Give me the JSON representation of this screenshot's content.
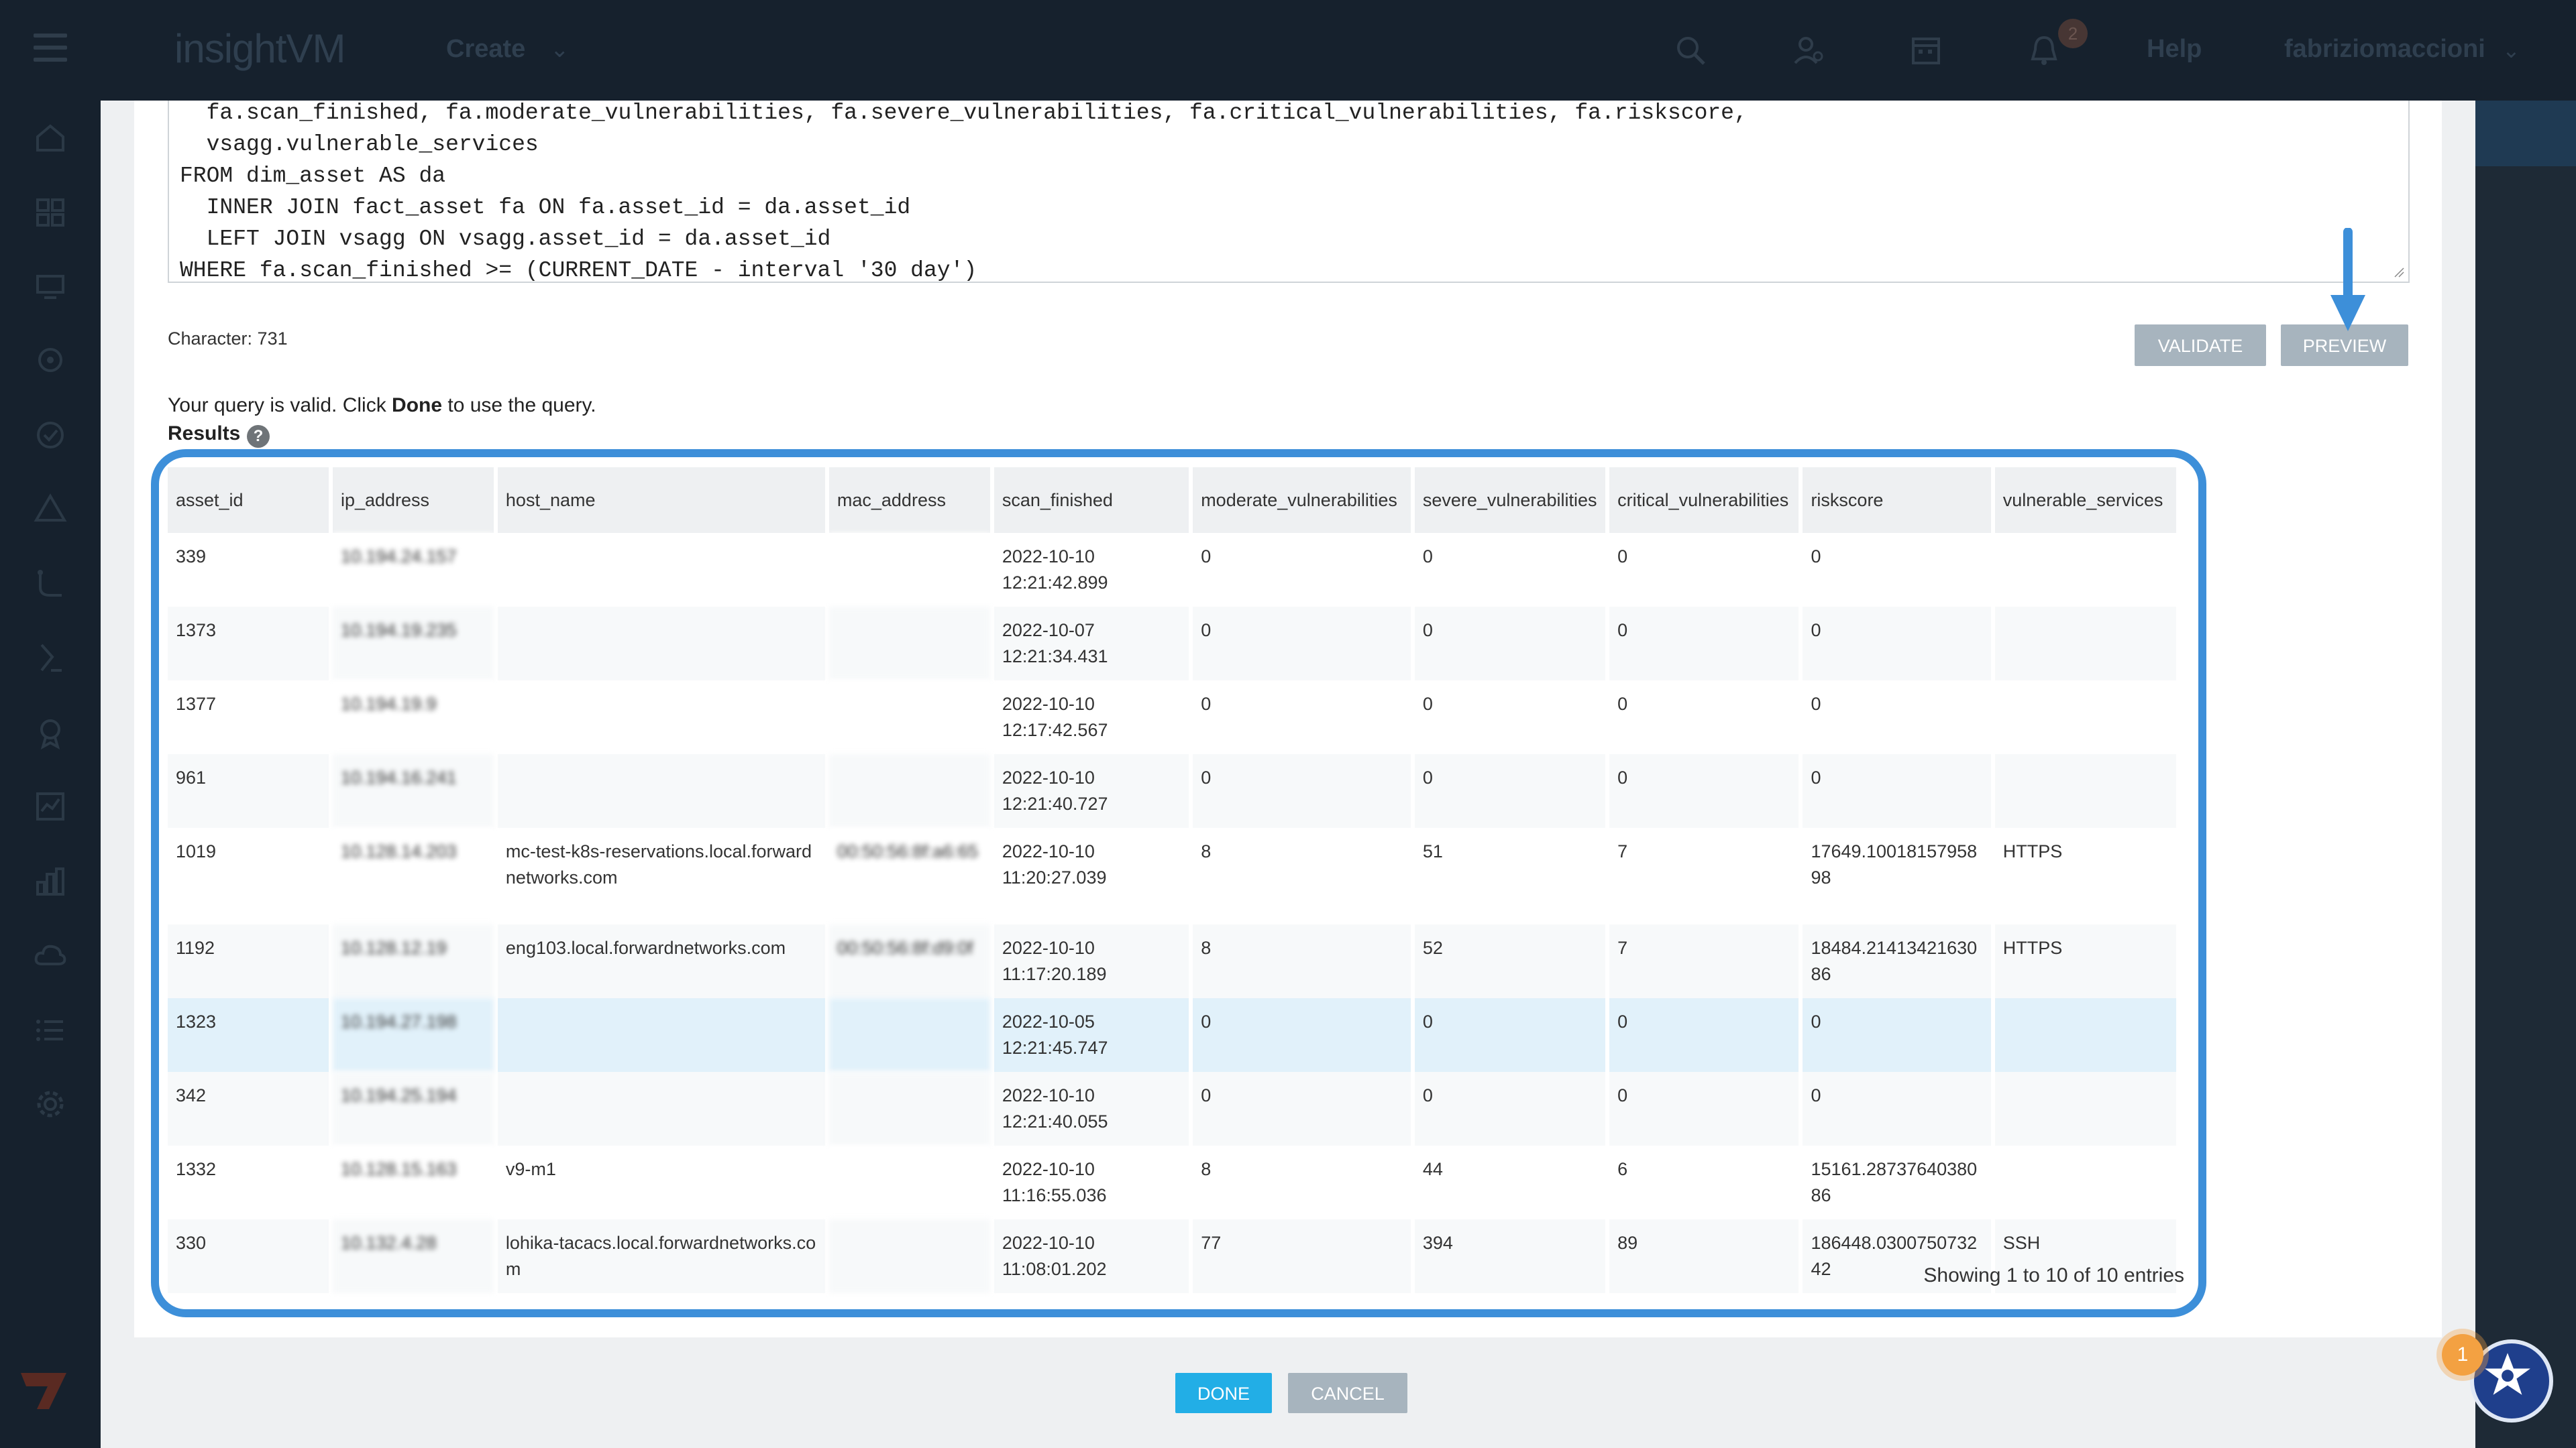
{
  "nav": {
    "logo": "insightVM",
    "create": "Create",
    "help": "Help",
    "user": "fabriziomaccioni",
    "notification_count": "2"
  },
  "sql": {
    "lines": [
      "  fa.scan_finished, fa.moderate_vulnerabilities, fa.severe_vulnerabilities, fa.critical_vulnerabilities, fa.riskscore,",
      "  vsagg.vulnerable_services",
      "FROM dim_asset AS da",
      "  INNER JOIN fact_asset fa ON fa.asset_id = da.asset_id",
      "  LEFT JOIN vsagg ON vsagg.asset_id = da.asset_id",
      "WHERE fa.scan_finished >= (CURRENT_DATE - interval '30 day')"
    ]
  },
  "editor": {
    "character_count": "Character: 731",
    "validate_label": "VALIDATE",
    "preview_label": "PREVIEW",
    "valid_msg_pre": "Your query is valid. Click ",
    "valid_msg_bold": "Done",
    "valid_msg_post": " to use the query.",
    "results_label": "Results",
    "help_glyph": "?"
  },
  "table": {
    "columns": [
      "asset_id",
      "ip_address",
      "host_name",
      "mac_address",
      "scan_finished",
      "moderate_vulnerabilities",
      "severe_vulnerabilities",
      "critical_vulnerabilities",
      "riskscore",
      "vulnerable_services"
    ],
    "rows": [
      {
        "asset_id": "339",
        "ip": "10.194.24.157",
        "host": "",
        "mac": "",
        "scan_date": "2022-10-10",
        "scan_time": "12:21:42.899",
        "moderate": "0",
        "severe": "0",
        "critical": "0",
        "risk_a": "0",
        "risk_b": "",
        "services": ""
      },
      {
        "asset_id": "1373",
        "ip": "10.194.19.235",
        "host": "",
        "mac": "",
        "scan_date": "2022-10-07",
        "scan_time": "12:21:34.431",
        "moderate": "0",
        "severe": "0",
        "critical": "0",
        "risk_a": "0",
        "risk_b": "",
        "services": ""
      },
      {
        "asset_id": "1377",
        "ip": "10.194.19.9",
        "host": "",
        "mac": "",
        "scan_date": "2022-10-10",
        "scan_time": "12:17:42.567",
        "moderate": "0",
        "severe": "0",
        "critical": "0",
        "risk_a": "0",
        "risk_b": "",
        "services": ""
      },
      {
        "asset_id": "961",
        "ip": "10.194.16.241",
        "host": "",
        "mac": "",
        "scan_date": "2022-10-10",
        "scan_time": "12:21:40.727",
        "moderate": "0",
        "severe": "0",
        "critical": "0",
        "risk_a": "0",
        "risk_b": "",
        "services": ""
      },
      {
        "asset_id": "1019",
        "ip": "10.128.14.203",
        "host": "mc-test-k8s-reservations.local.forwardnetworks.com",
        "mac": "00:50:56:8f:a6:65",
        "scan_date": "2022-10-10",
        "scan_time": "11:20:27.039",
        "moderate": "8",
        "severe": "51",
        "critical": "7",
        "risk_a": "17649.10018157958",
        "risk_b": "98",
        "services": "HTTPS"
      },
      {
        "asset_id": "1192",
        "ip": "10.128.12.19",
        "host": "eng103.local.forwardnetworks.com",
        "mac": "00:50:56:8f:d9:0f",
        "scan_date": "2022-10-10",
        "scan_time": "11:17:20.189",
        "moderate": "8",
        "severe": "52",
        "critical": "7",
        "risk_a": "18484.21413421630",
        "risk_b": "86",
        "services": "HTTPS"
      },
      {
        "asset_id": "1323",
        "ip": "10.194.27.198",
        "host": "",
        "mac": "",
        "scan_date": "2022-10-05",
        "scan_time": "12:21:45.747",
        "moderate": "0",
        "severe": "0",
        "critical": "0",
        "risk_a": "0",
        "risk_b": "",
        "services": ""
      },
      {
        "asset_id": "342",
        "ip": "10.194.25.194",
        "host": "",
        "mac": "",
        "scan_date": "2022-10-10",
        "scan_time": "12:21:40.055",
        "moderate": "0",
        "severe": "0",
        "critical": "0",
        "risk_a": "0",
        "risk_b": "",
        "services": ""
      },
      {
        "asset_id": "1332",
        "ip": "10.128.15.163",
        "host": "v9-m1",
        "mac": "",
        "scan_date": "2022-10-10",
        "scan_time": "11:16:55.036",
        "moderate": "8",
        "severe": "44",
        "critical": "6",
        "risk_a": "15161.28737640380",
        "risk_b": "86",
        "services": ""
      },
      {
        "asset_id": "330",
        "ip": "10.132.4.28",
        "host": "lohika-tacacs.local.forwardnetworks.com",
        "mac": "",
        "scan_date": "2022-10-10",
        "scan_time": "11:08:01.202",
        "moderate": "77",
        "severe": "394",
        "critical": "89",
        "risk_a": "186448.0300750732",
        "risk_b": "42",
        "services": "SSH"
      }
    ],
    "showing": "Showing 1 to 10 of 10 entries"
  },
  "footer": {
    "done_label": "DONE",
    "cancel_label": "CANCEL"
  },
  "assist": {
    "badge": "1"
  },
  "colors": {
    "highlight": "#3d8fd9",
    "done": "#22aee6",
    "grey_button": "#a7b4be",
    "badge": "#f3a142"
  }
}
